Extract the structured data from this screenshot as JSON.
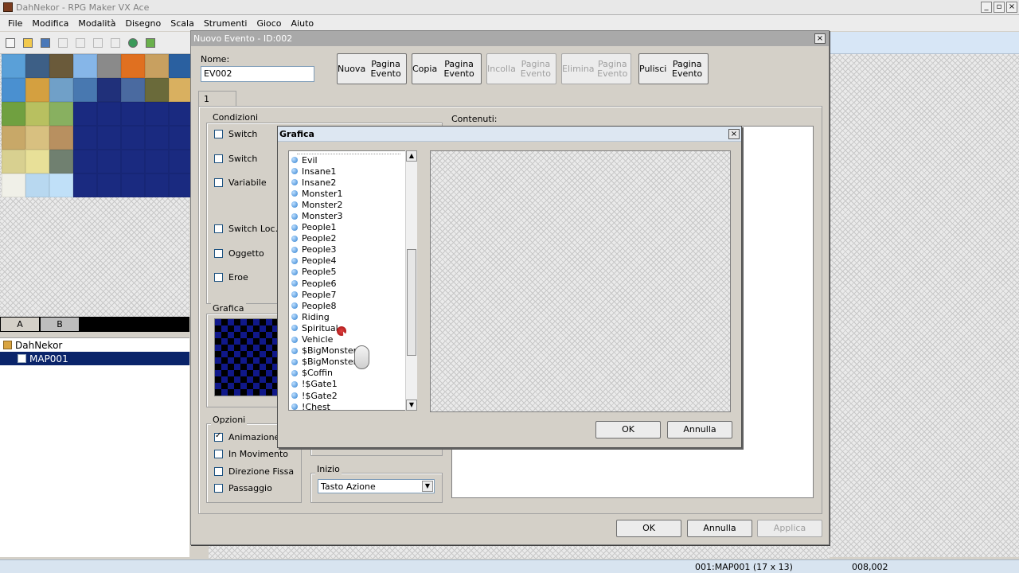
{
  "app": {
    "title": "DahNekor - RPG Maker VX Ace",
    "win_buttons": [
      "_",
      "▫",
      "×"
    ]
  },
  "menu": [
    "File",
    "Modifica",
    "Modalità",
    "Disegno",
    "Scala",
    "Strumenti",
    "Gioco",
    "Aiuto"
  ],
  "toolbar": {
    "icons": [
      "new-icon",
      "open-icon",
      "save-icon",
      "cut-icon",
      "copy-icon",
      "paste-icon",
      "delete-icon",
      "undo-icon",
      "layer-icon"
    ]
  },
  "tileset_tabs": [
    "A",
    "B"
  ],
  "map_tree": {
    "project": "DahNekor",
    "map": "MAP001"
  },
  "status": {
    "map_info": "001:MAP001 (17 x 13)",
    "coords": "008,002"
  },
  "event_dialog": {
    "title": "Nuovo Evento - ID:002",
    "close": "×",
    "name_label": "Nome:",
    "name_value": "EV002",
    "page_buttons": [
      {
        "line1": "Nuova",
        "line2": "Pagina Evento",
        "enabled": true
      },
      {
        "line1": "Copia",
        "line2": "Pagina Evento",
        "enabled": true
      },
      {
        "line1": "Incolla",
        "line2": "Pagina Evento",
        "enabled": false
      },
      {
        "line1": "Elimina",
        "line2": "Pagina Evento",
        "enabled": false
      },
      {
        "line1": "Pulisci",
        "line2": "Pagina Evento",
        "enabled": true
      }
    ],
    "page_tab": "1",
    "conditions_label": "Condizioni",
    "conditions": [
      "Switch",
      "Switch",
      "Variabile",
      "Switch Loc.",
      "Oggetto",
      "Eroe"
    ],
    "contents_label": "Contenuti:",
    "graphic_label": "Grafica",
    "options_label": "Opzioni",
    "options": [
      {
        "label": "Animazione",
        "checked": true
      },
      {
        "label": "In Movimento",
        "checked": false
      },
      {
        "label": "Direzione Fissa",
        "checked": false
      },
      {
        "label": "Passaggio",
        "checked": false
      }
    ],
    "trigger_label": "Inizio",
    "trigger_value": "Tasto Azione",
    "ok": "OK",
    "cancel": "Annulla",
    "apply": "Applica"
  },
  "graphic_dialog": {
    "title": "Grafica",
    "close": "×",
    "files": [
      "Evil",
      "Insane1",
      "Insane2",
      "Monster1",
      "Monster2",
      "Monster3",
      "People1",
      "People2",
      "People3",
      "People4",
      "People5",
      "People6",
      "People7",
      "People8",
      "Riding",
      "Spiritual",
      "Vehicle",
      "$BigMonster1",
      "$BigMonster2",
      "$Coffin",
      "!$Gate1",
      "!$Gate2",
      "!Chest"
    ],
    "ok": "OK",
    "cancel": "Annulla"
  },
  "colors": {
    "tile_colors": [
      "#5aa0d8",
      "#3d5f86",
      "#6a5a3a",
      "#86b6e8",
      "#8a8a8a",
      "#e07020",
      "#c8a060",
      "#2a60a0",
      "#4a90d0",
      "#d4a040",
      "#70a0c8",
      "#4878b0",
      "#20307a",
      "#4a6aa0",
      "#6a6a3a",
      "#d9b060",
      "#70a040",
      "#b8c060",
      "#88b060",
      "#1a2a80",
      "#1a2a80",
      "#1a2a80",
      "#1a2a80",
      "#1a2a80",
      "#c8a868",
      "#d8c080",
      "#b89060",
      "#1a2a80",
      "#1a2a80",
      "#1a2a80",
      "#1a2a80",
      "#1a2a80",
      "#d8d090",
      "#e8e098",
      "#708070",
      "#1a2a80",
      "#1a2a80",
      "#1a2a80",
      "#1a2a80",
      "#1a2a80",
      "#f0f0e8",
      "#b8d8f0",
      "#c0e0f8",
      "#1a2a80",
      "#1a2a80",
      "#1a2a80",
      "#1a2a80",
      "#1a2a80"
    ]
  }
}
